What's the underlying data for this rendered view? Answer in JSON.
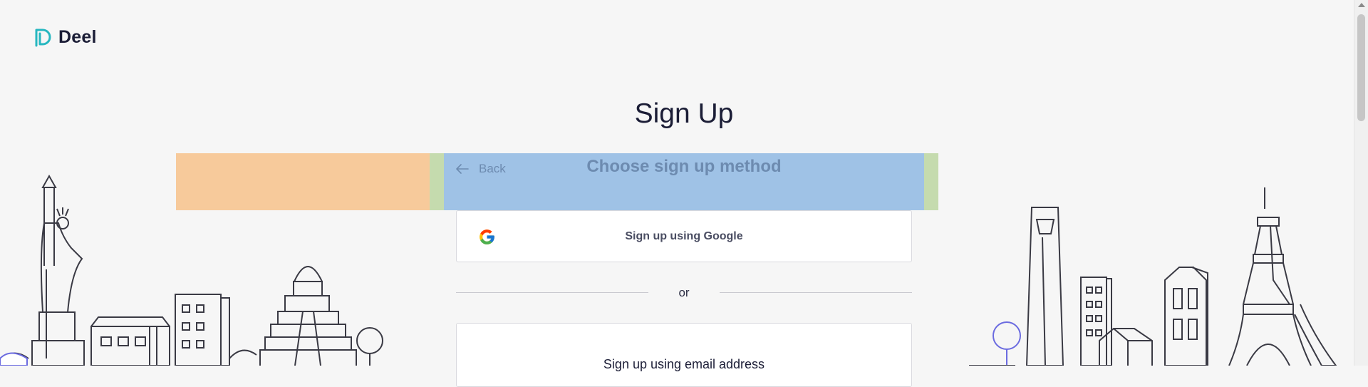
{
  "brand": {
    "name": "Deel",
    "logo_color": "#26b7c0"
  },
  "page": {
    "title": "Sign Up"
  },
  "panel": {
    "back_label": "Back",
    "subtitle": "Choose sign up method"
  },
  "methods": {
    "google_label": "Sign up using Google",
    "divider_label": "or",
    "email_label": "Sign up using email address"
  },
  "icons": {
    "logo": "deel-logo-icon",
    "back": "arrow-left-icon",
    "google": "google-icon"
  },
  "colors": {
    "background": "#f6f6f6",
    "text_primary": "#1b1d36",
    "overlay_orange": "#f7ca9b",
    "overlay_green": "#c5dbae",
    "overlay_blue": "#9fc2e6"
  }
}
